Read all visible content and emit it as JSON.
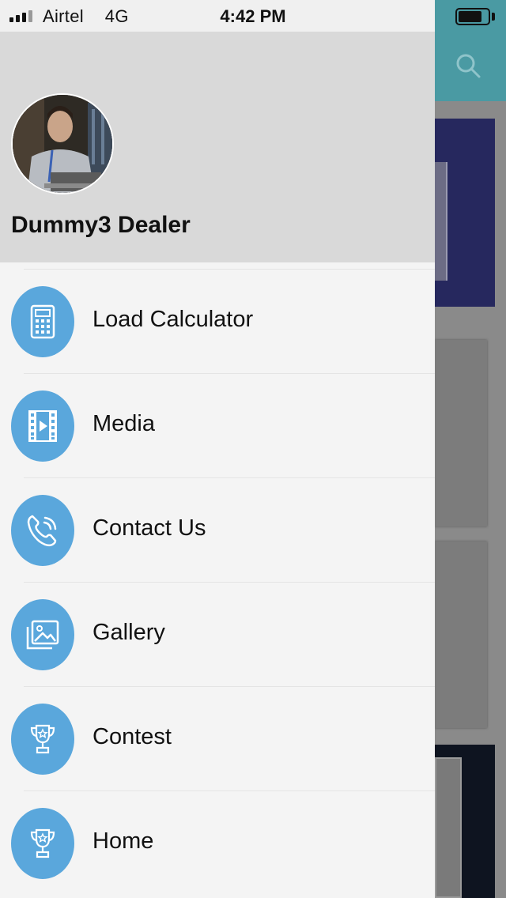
{
  "status_bar": {
    "carrier": "Airtel",
    "network": "4G",
    "time": "4:42 PM"
  },
  "drawer": {
    "user_name": "Dummy3 Dealer",
    "menu": [
      {
        "label": "Load Calculator",
        "icon": "calculator-icon"
      },
      {
        "label": "Media",
        "icon": "film-icon"
      },
      {
        "label": "Contact Us",
        "icon": "phone-icon"
      },
      {
        "label": "Gallery",
        "icon": "gallery-icon"
      },
      {
        "label": "Contest",
        "icon": "trophy-icon"
      },
      {
        "label": "Home",
        "icon": "trophy-icon"
      }
    ]
  },
  "colors": {
    "accent": "#5aa7dc",
    "header_bg": "#d9d9d9",
    "app_bar": "#4a9aa3"
  }
}
